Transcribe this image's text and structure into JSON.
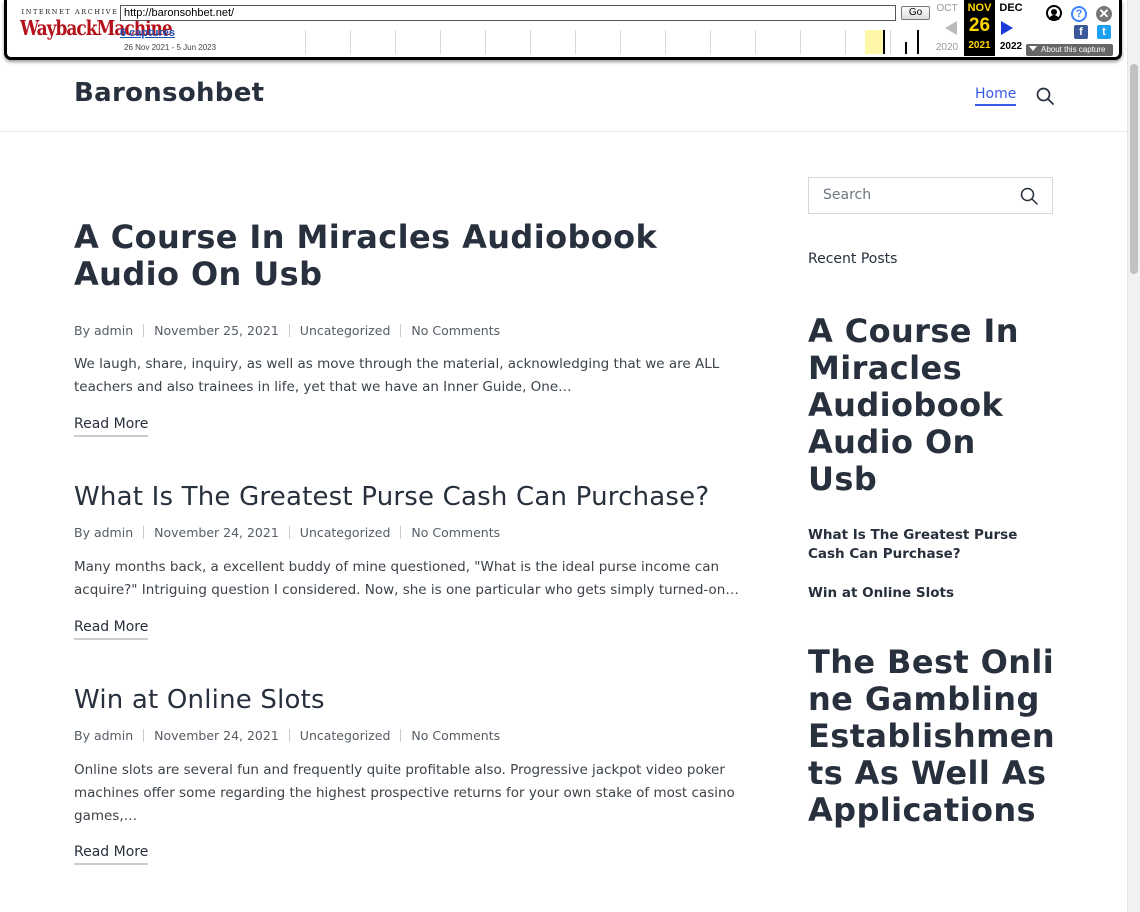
{
  "wayback": {
    "logo_top": "INTERNET ARCHIVE",
    "logo_main": "WaybackMachine",
    "url": "http://baronsohbet.net/",
    "go_label": "Go",
    "captures_label": "6 captures",
    "date_range": "26 Nov 2021 - 5 Jun 2023",
    "prev_month": "OCT",
    "prev_year": "2020",
    "cur_month": "NOV",
    "cur_day": "26",
    "cur_year": "2021",
    "next_month": "DEC",
    "next_year": "2022",
    "about_label": "About this capture",
    "help_glyph": "?",
    "close_glyph": "✕",
    "fb_glyph": "f",
    "tw_glyph": "t"
  },
  "site": {
    "title": "Baronsohbet",
    "nav_home": "Home"
  },
  "posts": [
    {
      "title": "A Course In Miracles Audiobook Audio On Usb",
      "author": "By admin",
      "date": "November 25, 2021",
      "category": "Uncategorized",
      "comments": "No Comments",
      "excerpt": "We laugh, share, inquiry, as well as move through the material, acknowledging that we are ALL teachers and also trainees in life, yet that we have an Inner Guide, One…",
      "read_more": "Read More"
    },
    {
      "title": "What Is The Greatest Purse Cash Can Purchase?",
      "author": "By admin",
      "date": "November 24, 2021",
      "category": "Uncategorized",
      "comments": "No Comments",
      "excerpt": "Many months back, a excellent buddy of mine questioned, \"What is the ideal purse income can acquire?\" Intriguing question I considered. Now, she is one particular who gets simply turned-on…",
      "read_more": "Read More"
    },
    {
      "title": "Win at Online Slots",
      "author": "By admin",
      "date": "November 24, 2021",
      "category": "Uncategorized",
      "comments": "No Comments",
      "excerpt": "Online slots are several fun and frequently quite profitable also. Progressive jackpot video poker machines offer some regarding the highest prospective returns for your own stake of most casino games,…",
      "read_more": "Read More"
    }
  ],
  "sidebar": {
    "search_placeholder": "Search",
    "recent_heading": "Recent Posts",
    "recent_posts": [
      "A Course In Miracles Audiobook Audio On Usb",
      "What Is The Greatest Purse Cash Can Purchase?",
      "Win at Online Slots"
    ],
    "big_title": "The Best Online Gambling Establishments As Well As Applications"
  },
  "colors": {
    "accent": "#3858e9",
    "text": "#28303d"
  }
}
